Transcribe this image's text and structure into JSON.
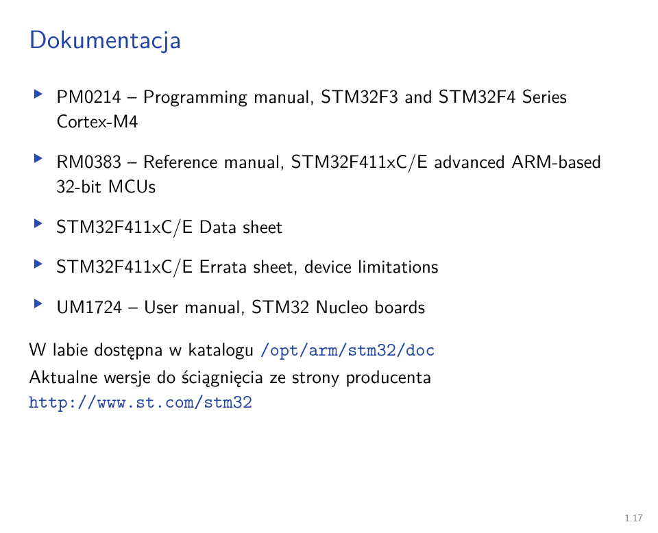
{
  "title": "Dokumentacja",
  "items": [
    "PM0214 – Programming manual, STM32F3 and STM32F4 Series Cortex-M4",
    "RM0383 – Reference manual, STM32F411xC/E advanced ARM-based 32-bit MCUs",
    "STM32F411xC/E Data sheet",
    "STM32F411xC/E Errata sheet, device limitations",
    "UM1724 – User manual, STM32 Nucleo boards"
  ],
  "location_prefix": "W labie dostępna w katalogu ",
  "location_path": "/opt/arm/stm32/doc",
  "download_prefix": "Aktualne wersje do ściągnięcia ze strony producenta ",
  "download_url": "http://www.st.com/stm32",
  "page_number": "1.17"
}
